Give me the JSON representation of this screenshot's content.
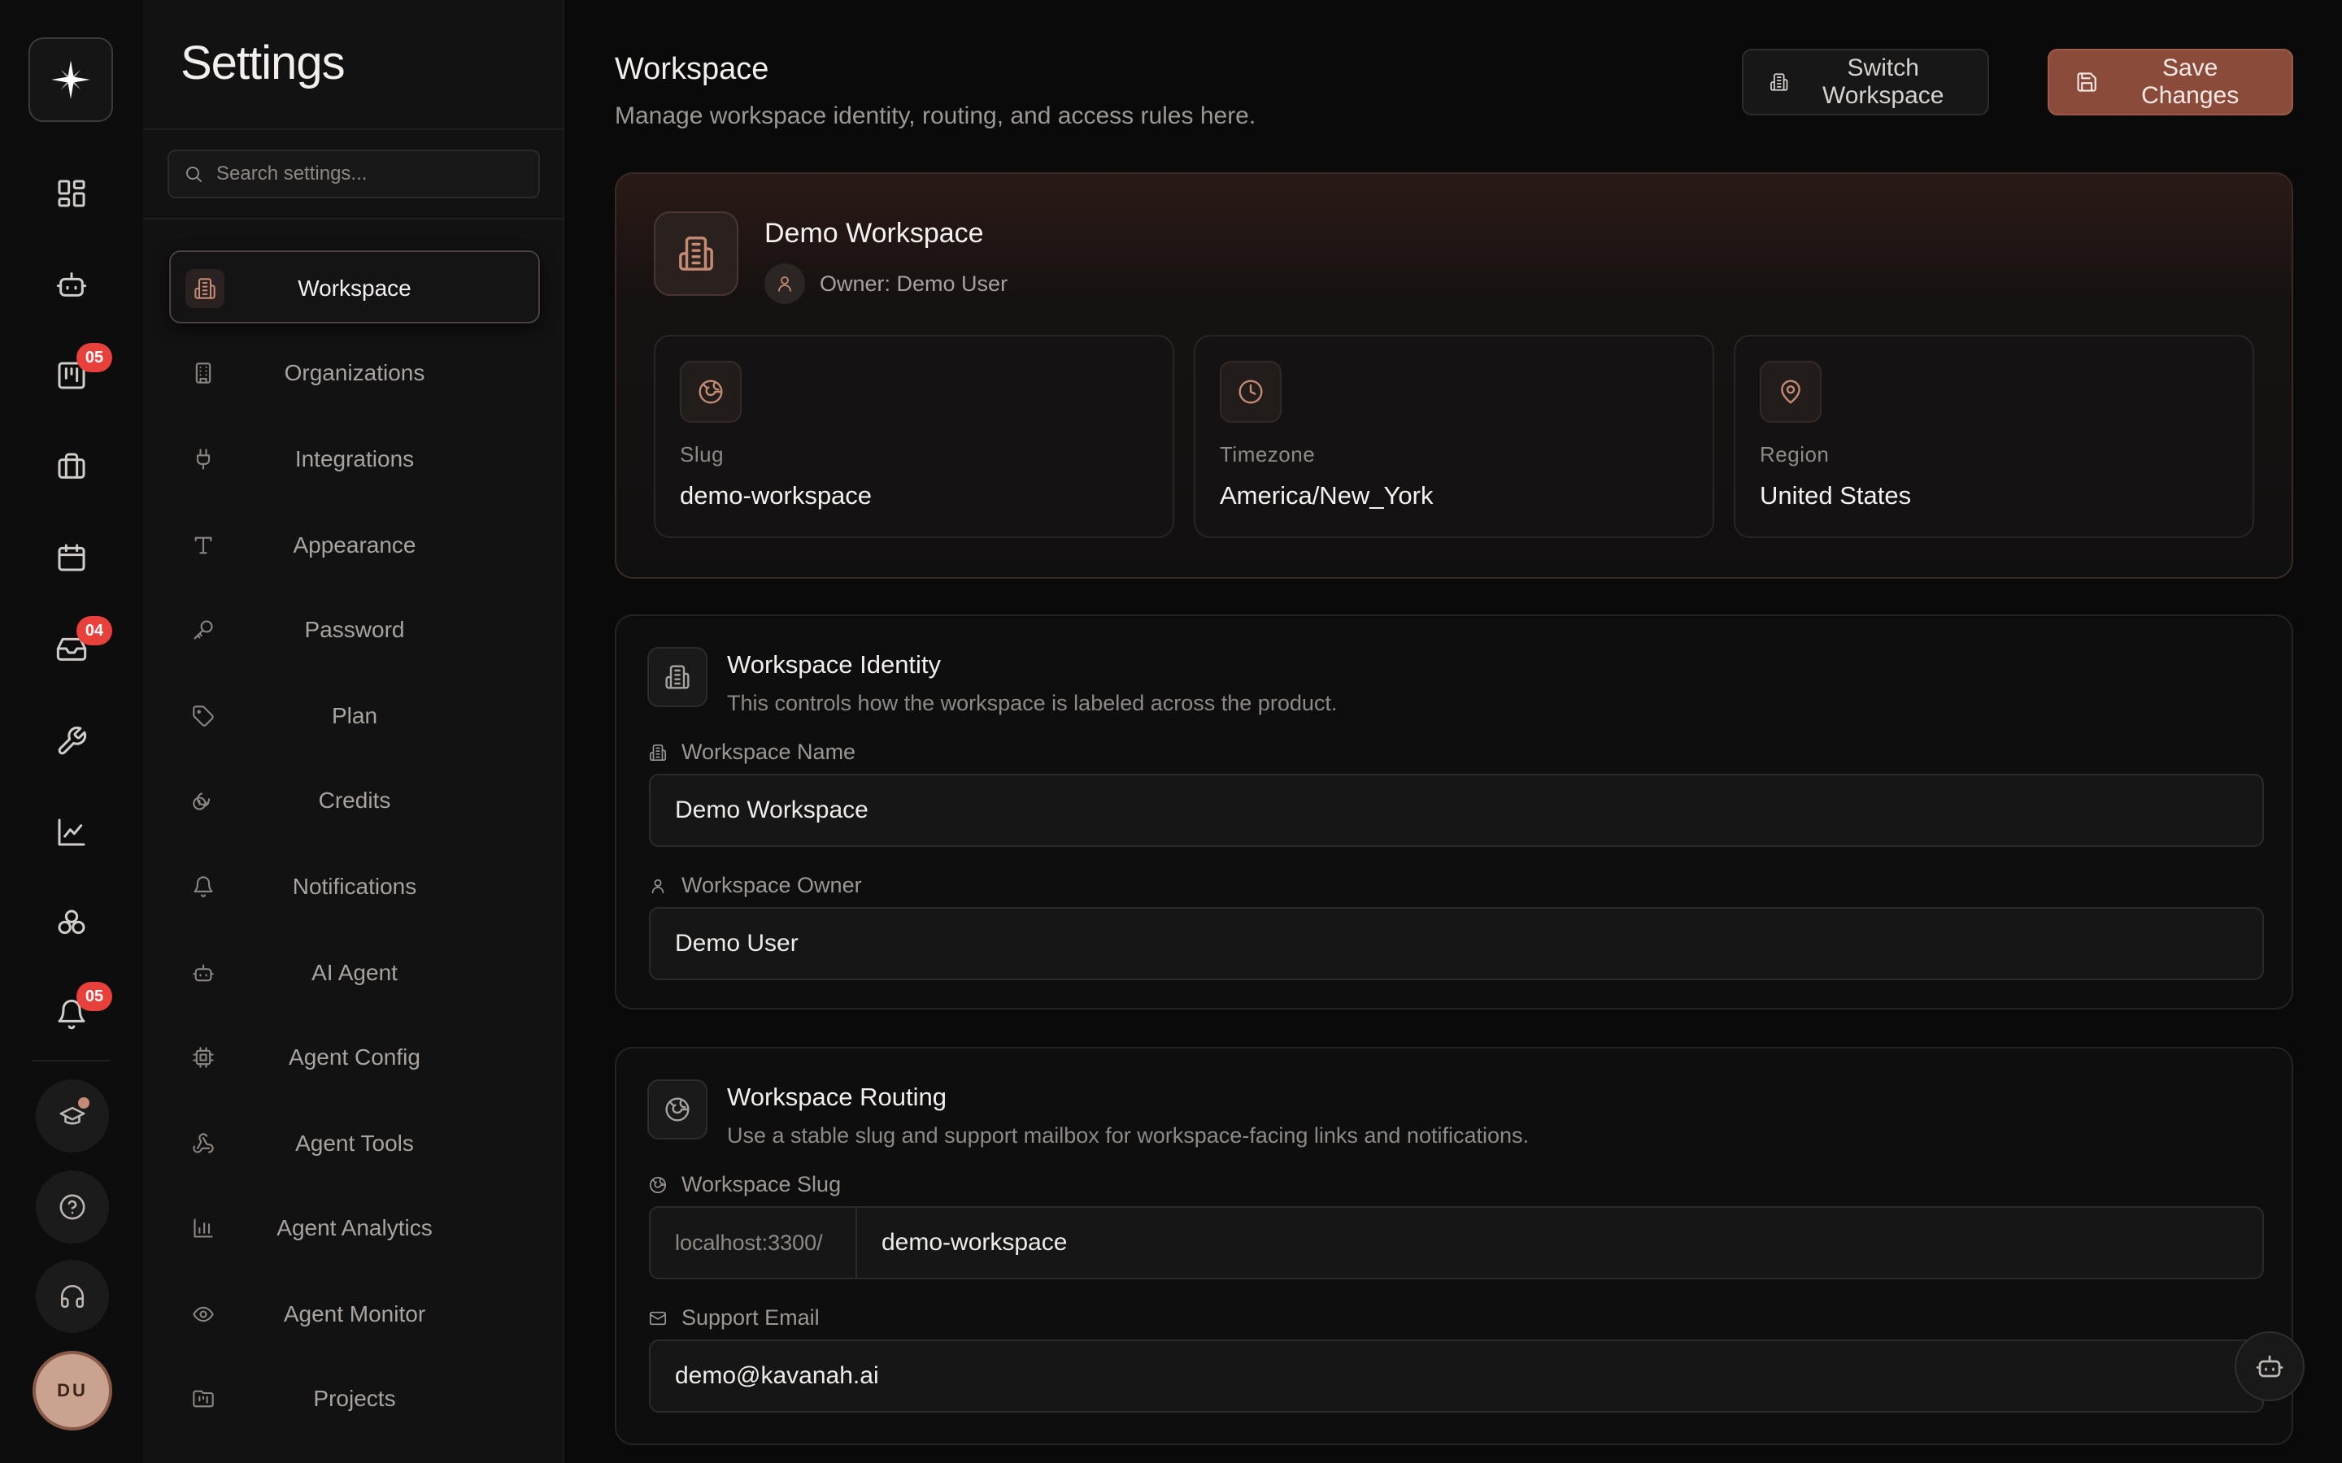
{
  "rail": {
    "badges": {
      "projects": "05",
      "inbox": "04",
      "notifications": "05"
    },
    "avatar_initials": "DU"
  },
  "sidebar": {
    "title": "Settings",
    "search_placeholder": "Search settings...",
    "items": [
      {
        "label": "Workspace",
        "icon": "building-icon",
        "active": true
      },
      {
        "label": "Organizations",
        "icon": "office-icon"
      },
      {
        "label": "Integrations",
        "icon": "plug-icon"
      },
      {
        "label": "Appearance",
        "icon": "type-icon"
      },
      {
        "label": "Password",
        "icon": "key-icon"
      },
      {
        "label": "Plan",
        "icon": "tag-icon"
      },
      {
        "label": "Credits",
        "icon": "coins-icon"
      },
      {
        "label": "Notifications",
        "icon": "bell-icon"
      },
      {
        "label": "AI Agent",
        "icon": "bot-icon"
      },
      {
        "label": "Agent Config",
        "icon": "cpu-icon"
      },
      {
        "label": "Agent Tools",
        "icon": "webhook-icon"
      },
      {
        "label": "Agent Analytics",
        "icon": "bar-chart-icon"
      },
      {
        "label": "Agent Monitor",
        "icon": "eye-icon"
      },
      {
        "label": "Projects",
        "icon": "folder-icon"
      }
    ]
  },
  "header": {
    "title": "Workspace",
    "subtitle": "Manage workspace identity, routing, and access rules here.",
    "switch_label": "Switch Workspace",
    "save_label": "Save Changes"
  },
  "hero": {
    "name": "Demo Workspace",
    "owner": "Owner: Demo User",
    "stats": [
      {
        "label": "Slug",
        "value": "demo-workspace",
        "icon": "globe-icon"
      },
      {
        "label": "Timezone",
        "value": "America/New_York",
        "icon": "clock-icon"
      },
      {
        "label": "Region",
        "value": "United States",
        "icon": "map-pin-icon"
      }
    ]
  },
  "identity": {
    "title": "Workspace Identity",
    "description": "This controls how the workspace is labeled across the product.",
    "name_label": "Workspace Name",
    "name_value": "Demo Workspace",
    "owner_label": "Workspace Owner",
    "owner_value": "Demo User"
  },
  "routing": {
    "title": "Workspace Routing",
    "description": "Use a stable slug and support mailbox for workspace-facing links and notifications.",
    "slug_label": "Workspace Slug",
    "slug_prefix": "localhost:3300/",
    "slug_value": "demo-workspace",
    "email_label": "Support Email",
    "email_value": "demo@kavanah.ai"
  },
  "colors": {
    "accent": "#8a4b3a",
    "accent_icon": "#c38a74",
    "badge": "#e8403a",
    "background": "#0a0a0a"
  }
}
